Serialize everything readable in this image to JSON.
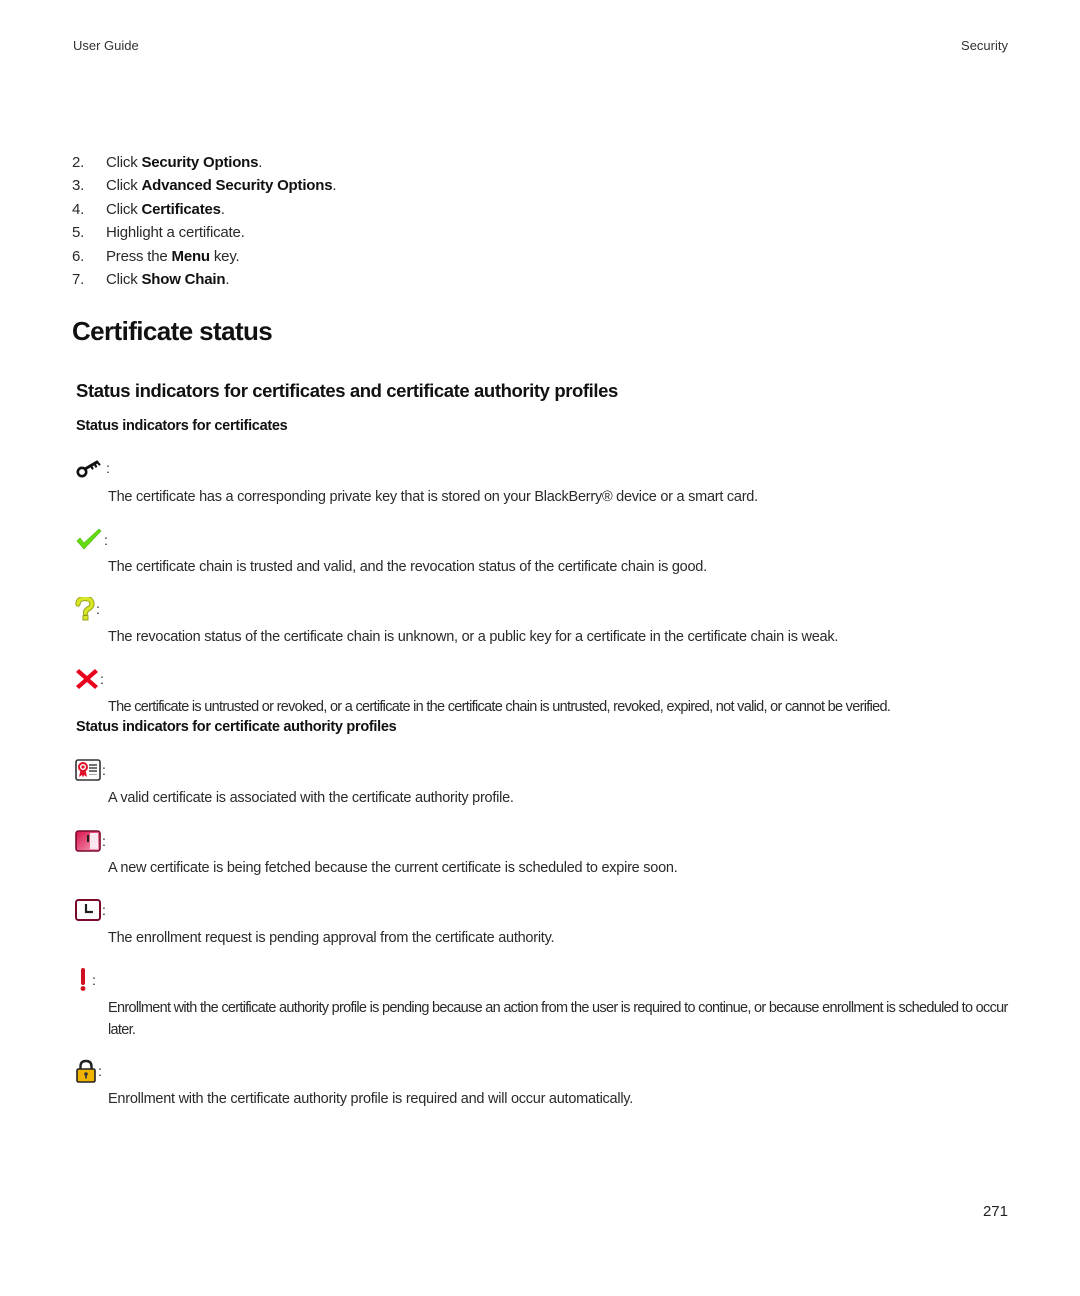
{
  "header": {
    "left": "User Guide",
    "right": "Security"
  },
  "steps": [
    {
      "num": "2.",
      "pre": "Click ",
      "bold": "Security Options",
      "post": "."
    },
    {
      "num": "3.",
      "pre": "Click ",
      "bold": "Advanced Security Options",
      "post": "."
    },
    {
      "num": "4.",
      "pre": "Click ",
      "bold": "Certificates",
      "post": "."
    },
    {
      "num": "5.",
      "pre": "Highlight a certificate.",
      "bold": "",
      "post": ""
    },
    {
      "num": "6.",
      "pre": "Press the ",
      "bold": "Menu",
      "post": " key."
    },
    {
      "num": "7.",
      "pre": "Click ",
      "bold": "Show Chain",
      "post": "."
    }
  ],
  "section_title": "Certificate status",
  "subsection_title": "Status indicators for certificates and certificate authority profiles",
  "certificates": {
    "heading": "Status indicators for certificates",
    "items": [
      {
        "icon": "key-icon",
        "colon": ":",
        "text": "The certificate has a corresponding private key that is stored on your BlackBerry® device or a smart card."
      },
      {
        "icon": "checkmark-icon",
        "colon": ":",
        "text": "The certificate chain is trusted and valid, and the revocation status of the certificate chain is good."
      },
      {
        "icon": "question-mark-icon",
        "colon": ":",
        "text": "The revocation status of the certificate chain is unknown, or a public key for a certificate in the certificate chain is weak."
      },
      {
        "icon": "red-x-icon",
        "colon": ":",
        "text": "The certificate is untrusted or revoked, or a certificate in the certificate chain is untrusted, revoked, expired, not valid, or cannot be verified."
      }
    ]
  },
  "ca_profiles": {
    "heading": "Status indicators for certificate authority profiles",
    "items": [
      {
        "icon": "valid-certificate-icon",
        "colon": ":",
        "text": "A valid certificate is associated with the certificate authority profile."
      },
      {
        "icon": "certificate-expiring-icon",
        "colon": ":",
        "text": "A new certificate is being fetched because the current certificate is scheduled to expire soon."
      },
      {
        "icon": "clock-pending-icon",
        "colon": ":",
        "text": "The enrollment request is pending approval from the certificate authority."
      },
      {
        "icon": "exclamation-icon",
        "colon": " :",
        "text": "Enrollment with the certificate authority profile is pending because an action from the user is required to continue, or because enrollment is scheduled to occur later."
      },
      {
        "icon": "padlock-icon",
        "colon": ":",
        "text": "Enrollment with the certificate authority profile is required and will occur automatically."
      }
    ]
  },
  "colors": {
    "check_green": "#66dd11",
    "question_yellow": "#d4e020",
    "x_red": "#e8001c",
    "ca_crimson": "#b0123a",
    "lock_gold": "#f0b400"
  },
  "page_number": "271"
}
